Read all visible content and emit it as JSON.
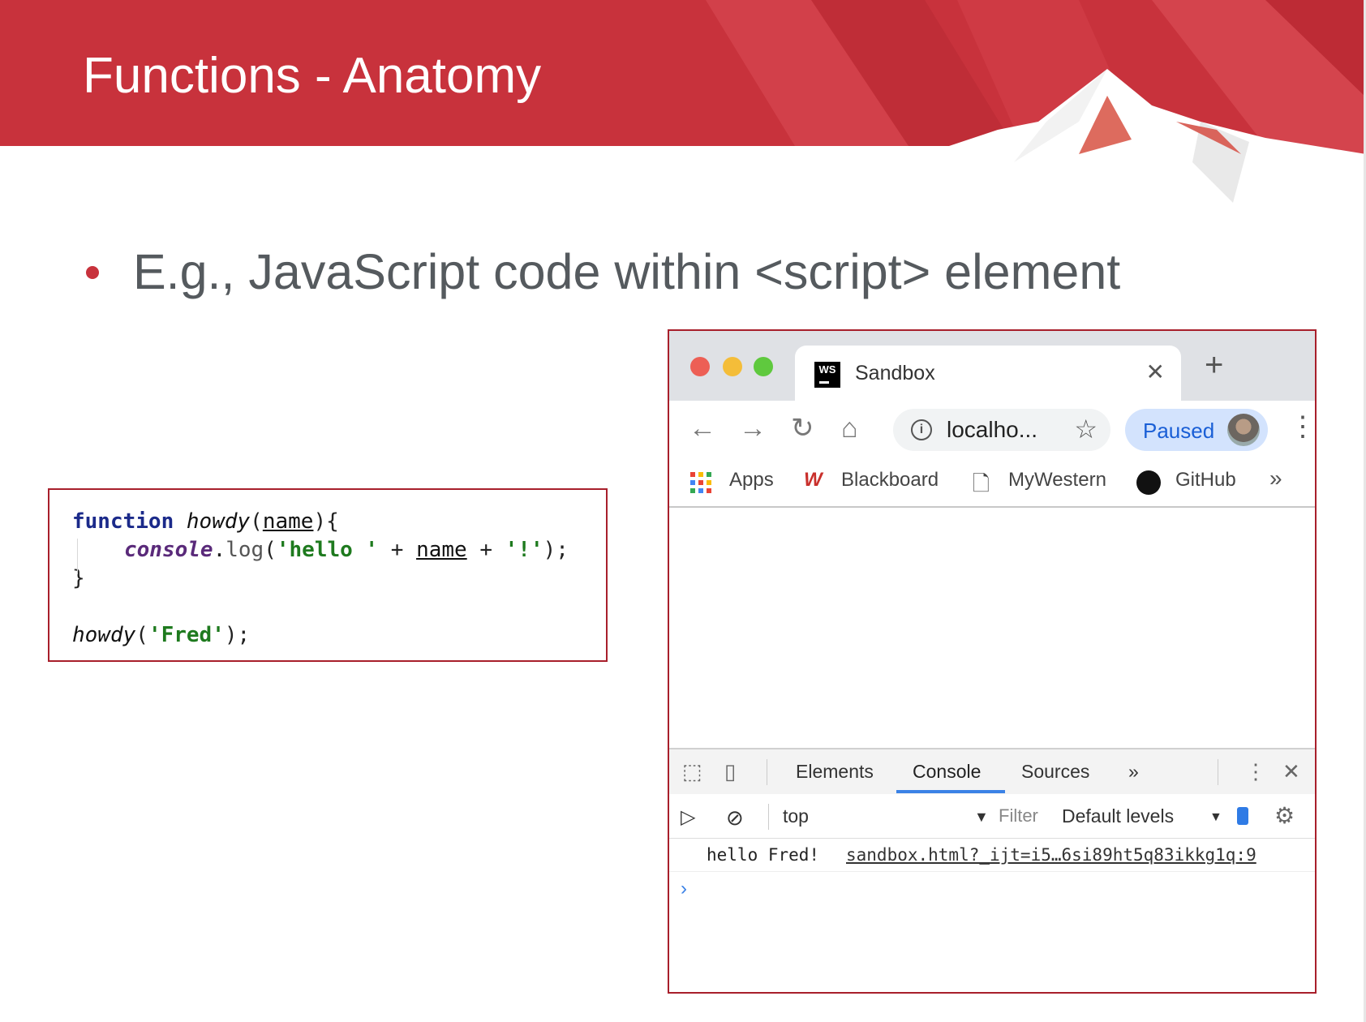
{
  "slide": {
    "title": "Functions - Anatomy",
    "bullet": "E.g., JavaScript code within <script> element"
  },
  "code": {
    "line1": {
      "keyword": "function",
      "name": "howdy",
      "param": "name",
      "open": "){"
    },
    "line2": {
      "obj": "console",
      "dot": ".",
      "method": "log",
      "str1": "'hello '",
      "param": "name",
      "str2": "'!'"
    },
    "line3": "}",
    "line5": {
      "fn": "howdy",
      "str": "'Fred'"
    }
  },
  "browser": {
    "tab_title": "Sandbox",
    "tab_icon_text": "WS",
    "tab_close": "✕",
    "new_tab": "+",
    "url": "localho...",
    "profile_label": "Paused",
    "bookmarks": [
      {
        "label": "Apps"
      },
      {
        "label": "Blackboard"
      },
      {
        "label": "MyWestern"
      },
      {
        "label": "GitHub"
      }
    ],
    "bookmarks_more": "»"
  },
  "devtools": {
    "tabs": [
      "Elements",
      "Console",
      "Sources"
    ],
    "more_tabs": "»",
    "active_tab": "Console",
    "context": "top",
    "filter_placeholder": "Filter",
    "levels": "Default levels",
    "log_message": "hello Fred!",
    "log_source": "sandbox.html?_ijt=i5…6si89ht5q83ikkg1q:9",
    "prompt": "›"
  },
  "colors": {
    "banner_red": "#c8323c",
    "border_red": "#a81f2b",
    "accent_blue": "#3b82e6"
  }
}
